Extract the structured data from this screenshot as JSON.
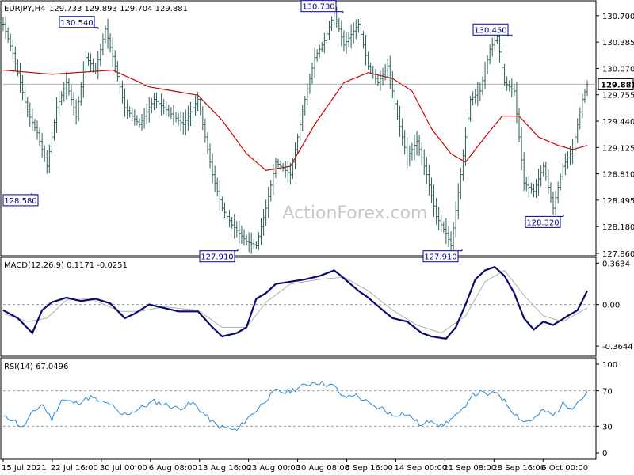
{
  "chart_data": [
    {
      "type": "ohlc",
      "symbol_header": "EURJPY,H4",
      "ohlc_header": "129.733 129.893 129.704 129.881",
      "current_price": "129.881",
      "ylim": [
        127.86,
        130.85
      ],
      "y_ticks": [
        "130.700",
        "130.385",
        "130.070",
        "129.755",
        "129.440",
        "129.125",
        "128.810",
        "128.495",
        "128.180",
        "127.860"
      ],
      "annotations": [
        {
          "text": "128.580",
          "value": 128.58
        },
        {
          "text": "130.540",
          "value": 130.54
        },
        {
          "text": "127.910",
          "value": 127.91
        },
        {
          "text": "130.730",
          "value": 130.73
        },
        {
          "text": "127.910",
          "value": 127.91
        },
        {
          "text": "130.450",
          "value": 130.45
        },
        {
          "text": "128.320",
          "value": 128.32
        }
      ],
      "price_path": [
        [
          0,
          130.6
        ],
        [
          4,
          130.25
        ],
        [
          10,
          129.55
        ],
        [
          14,
          129.3
        ],
        [
          18,
          128.9
        ],
        [
          22,
          129.6
        ],
        [
          26,
          129.9
        ],
        [
          30,
          129.5
        ],
        [
          34,
          130.2
        ],
        [
          38,
          130.05
        ],
        [
          42,
          130.54
        ],
        [
          46,
          130.1
        ],
        [
          50,
          129.6
        ],
        [
          56,
          129.4
        ],
        [
          62,
          129.7
        ],
        [
          68,
          129.55
        ],
        [
          74,
          129.4
        ],
        [
          80,
          129.7
        ],
        [
          86,
          128.8
        ],
        [
          90,
          128.4
        ],
        [
          94,
          128.2
        ],
        [
          100,
          128.0
        ],
        [
          104,
          127.95
        ],
        [
          108,
          128.4
        ],
        [
          112,
          128.95
        ],
        [
          118,
          128.8
        ],
        [
          124,
          129.7
        ],
        [
          128,
          130.2
        ],
        [
          132,
          130.4
        ],
        [
          136,
          130.73
        ],
        [
          140,
          130.35
        ],
        [
          146,
          130.6
        ],
        [
          150,
          130.1
        ],
        [
          154,
          129.9
        ],
        [
          158,
          130.1
        ],
        [
          162,
          129.5
        ],
        [
          166,
          129.0
        ],
        [
          170,
          129.2
        ],
        [
          174,
          128.8
        ],
        [
          178,
          128.3
        ],
        [
          182,
          128.1
        ],
        [
          184,
          127.95
        ],
        [
          188,
          128.8
        ],
        [
          192,
          129.7
        ],
        [
          196,
          129.8
        ],
        [
          200,
          130.3
        ],
        [
          203,
          130.45
        ],
        [
          206,
          129.9
        ],
        [
          210,
          129.8
        ],
        [
          214,
          128.7
        ],
        [
          218,
          128.6
        ],
        [
          222,
          128.9
        ],
        [
          226,
          128.4
        ],
        [
          230,
          128.9
        ],
        [
          234,
          129.1
        ],
        [
          238,
          129.7
        ],
        [
          240,
          129.88
        ]
      ],
      "moving_average": [
        [
          0,
          130.05
        ],
        [
          20,
          130.0
        ],
        [
          45,
          130.05
        ],
        [
          60,
          129.85
        ],
        [
          80,
          129.75
        ],
        [
          90,
          129.45
        ],
        [
          100,
          129.05
        ],
        [
          108,
          128.85
        ],
        [
          118,
          128.9
        ],
        [
          128,
          129.4
        ],
        [
          140,
          129.9
        ],
        [
          150,
          130.02
        ],
        [
          160,
          129.95
        ],
        [
          168,
          129.8
        ],
        [
          176,
          129.35
        ],
        [
          184,
          129.05
        ],
        [
          190,
          128.95
        ],
        [
          198,
          129.25
        ],
        [
          205,
          129.5
        ],
        [
          212,
          129.5
        ],
        [
          220,
          129.25
        ],
        [
          228,
          129.15
        ],
        [
          234,
          129.1
        ],
        [
          240,
          129.15
        ]
      ],
      "grid": false
    },
    {
      "type": "line",
      "title": "MACD(12,26,9) 0.1171 -0.0251",
      "ylim": [
        -0.44,
        0.4
      ],
      "y_ticks": [
        "0.3634",
        "0.00",
        "-0.3644"
      ],
      "current_value_label": "0.00",
      "series": [
        {
          "values": [
            [
              0,
              -0.05
            ],
            [
              6,
              -0.12
            ],
            [
              12,
              -0.25
            ],
            [
              16,
              -0.05
            ],
            [
              20,
              0.02
            ],
            [
              26,
              0.06
            ],
            [
              32,
              0.03
            ],
            [
              38,
              0.05
            ],
            [
              44,
              0.01
            ],
            [
              50,
              -0.12
            ],
            [
              54,
              -0.08
            ],
            [
              60,
              0.0
            ],
            [
              66,
              -0.03
            ],
            [
              72,
              -0.06
            ],
            [
              80,
              -0.06
            ],
            [
              86,
              -0.2
            ],
            [
              90,
              -0.28
            ],
            [
              96,
              -0.25
            ],
            [
              100,
              -0.2
            ],
            [
              104,
              0.05
            ],
            [
              108,
              0.1
            ],
            [
              112,
              0.18
            ],
            [
              118,
              0.2
            ],
            [
              124,
              0.22
            ],
            [
              130,
              0.25
            ],
            [
              136,
              0.3
            ],
            [
              140,
              0.23
            ],
            [
              146,
              0.12
            ],
            [
              150,
              0.06
            ],
            [
              156,
              -0.05
            ],
            [
              160,
              -0.12
            ],
            [
              166,
              -0.15
            ],
            [
              172,
              -0.25
            ],
            [
              176,
              -0.28
            ],
            [
              182,
              -0.3
            ],
            [
              186,
              -0.2
            ],
            [
              190,
              0.0
            ],
            [
              194,
              0.22
            ],
            [
              198,
              0.3
            ],
            [
              202,
              0.33
            ],
            [
              206,
              0.25
            ],
            [
              210,
              0.1
            ],
            [
              214,
              -0.12
            ],
            [
              218,
              -0.22
            ],
            [
              222,
              -0.15
            ],
            [
              226,
              -0.18
            ],
            [
              232,
              -0.1
            ],
            [
              236,
              -0.05
            ],
            [
              240,
              0.12
            ]
          ]
        },
        {
          "values": [
            [
              0,
              -0.08
            ],
            [
              10,
              -0.15
            ],
            [
              18,
              -0.12
            ],
            [
              26,
              0.04
            ],
            [
              36,
              0.05
            ],
            [
              48,
              -0.06
            ],
            [
              56,
              -0.06
            ],
            [
              66,
              -0.02
            ],
            [
              80,
              -0.05
            ],
            [
              90,
              -0.2
            ],
            [
              100,
              -0.2
            ],
            [
              108,
              0.02
            ],
            [
              118,
              0.18
            ],
            [
              130,
              0.22
            ],
            [
              140,
              0.24
            ],
            [
              150,
              0.12
            ],
            [
              160,
              -0.05
            ],
            [
              170,
              -0.18
            ],
            [
              180,
              -0.25
            ],
            [
              190,
              -0.1
            ],
            [
              198,
              0.2
            ],
            [
              206,
              0.3
            ],
            [
              214,
              0.08
            ],
            [
              222,
              -0.1
            ],
            [
              230,
              -0.15
            ],
            [
              240,
              -0.03
            ]
          ]
        }
      ]
    },
    {
      "type": "line",
      "title": "RSI(14) 67.0496",
      "ylim": [
        0,
        100
      ],
      "y_ticks": [
        "100",
        "70",
        "30",
        "0"
      ],
      "levels": [
        70,
        30
      ],
      "series": [
        {
          "values": [
            [
              0,
              40
            ],
            [
              4,
              38
            ],
            [
              8,
              28
            ],
            [
              12,
              45
            ],
            [
              16,
              55
            ],
            [
              20,
              38
            ],
            [
              24,
              60
            ],
            [
              30,
              56
            ],
            [
              36,
              63
            ],
            [
              40,
              57
            ],
            [
              44,
              55
            ],
            [
              48,
              43
            ],
            [
              52,
              45
            ],
            [
              56,
              50
            ],
            [
              62,
              58
            ],
            [
              66,
              55
            ],
            [
              72,
              50
            ],
            [
              78,
              56
            ],
            [
              84,
              40
            ],
            [
              88,
              30
            ],
            [
              92,
              28
            ],
            [
              96,
              25
            ],
            [
              100,
              38
            ],
            [
              104,
              48
            ],
            [
              108,
              60
            ],
            [
              112,
              70
            ],
            [
              116,
              68
            ],
            [
              120,
              72
            ],
            [
              124,
              76
            ],
            [
              128,
              80
            ],
            [
              132,
              78
            ],
            [
              136,
              75
            ],
            [
              140,
              62
            ],
            [
              144,
              66
            ],
            [
              148,
              60
            ],
            [
              152,
              52
            ],
            [
              156,
              50
            ],
            [
              160,
              42
            ],
            [
              164,
              45
            ],
            [
              168,
              40
            ],
            [
              172,
              30
            ],
            [
              176,
              38
            ],
            [
              180,
              30
            ],
            [
              184,
              38
            ],
            [
              188,
              45
            ],
            [
              192,
              64
            ],
            [
              196,
              68
            ],
            [
              200,
              65
            ],
            [
              203,
              69
            ],
            [
              206,
              58
            ],
            [
              210,
              45
            ],
            [
              214,
              35
            ],
            [
              218,
              38
            ],
            [
              222,
              48
            ],
            [
              226,
              42
            ],
            [
              230,
              55
            ],
            [
              234,
              52
            ],
            [
              237,
              60
            ],
            [
              240,
              67
            ]
          ]
        }
      ]
    }
  ],
  "x_axis": {
    "labels": [
      "15 Jul 2021",
      "22 Jul 16:00",
      "30 Jul 00:00",
      "6 Aug 08:00",
      "13 Aug 16:00",
      "23 Aug 00:00",
      "30 Aug 08:00",
      "6 Sep 16:00",
      "14 Sep 00:00",
      "21 Sep 08:00",
      "28 Sep 16:00",
      "6 Oct 00:00"
    ]
  },
  "watermark": "ActionForex.com",
  "colors": {
    "price_bars": "#2f5f5a",
    "moving_average": "#cc0000",
    "macd": "#0a0a6e",
    "macd_signal": "#b0b0b0",
    "rsi": "#2a8bd6",
    "label_border": "#0000a0",
    "label_text": "#000080"
  }
}
